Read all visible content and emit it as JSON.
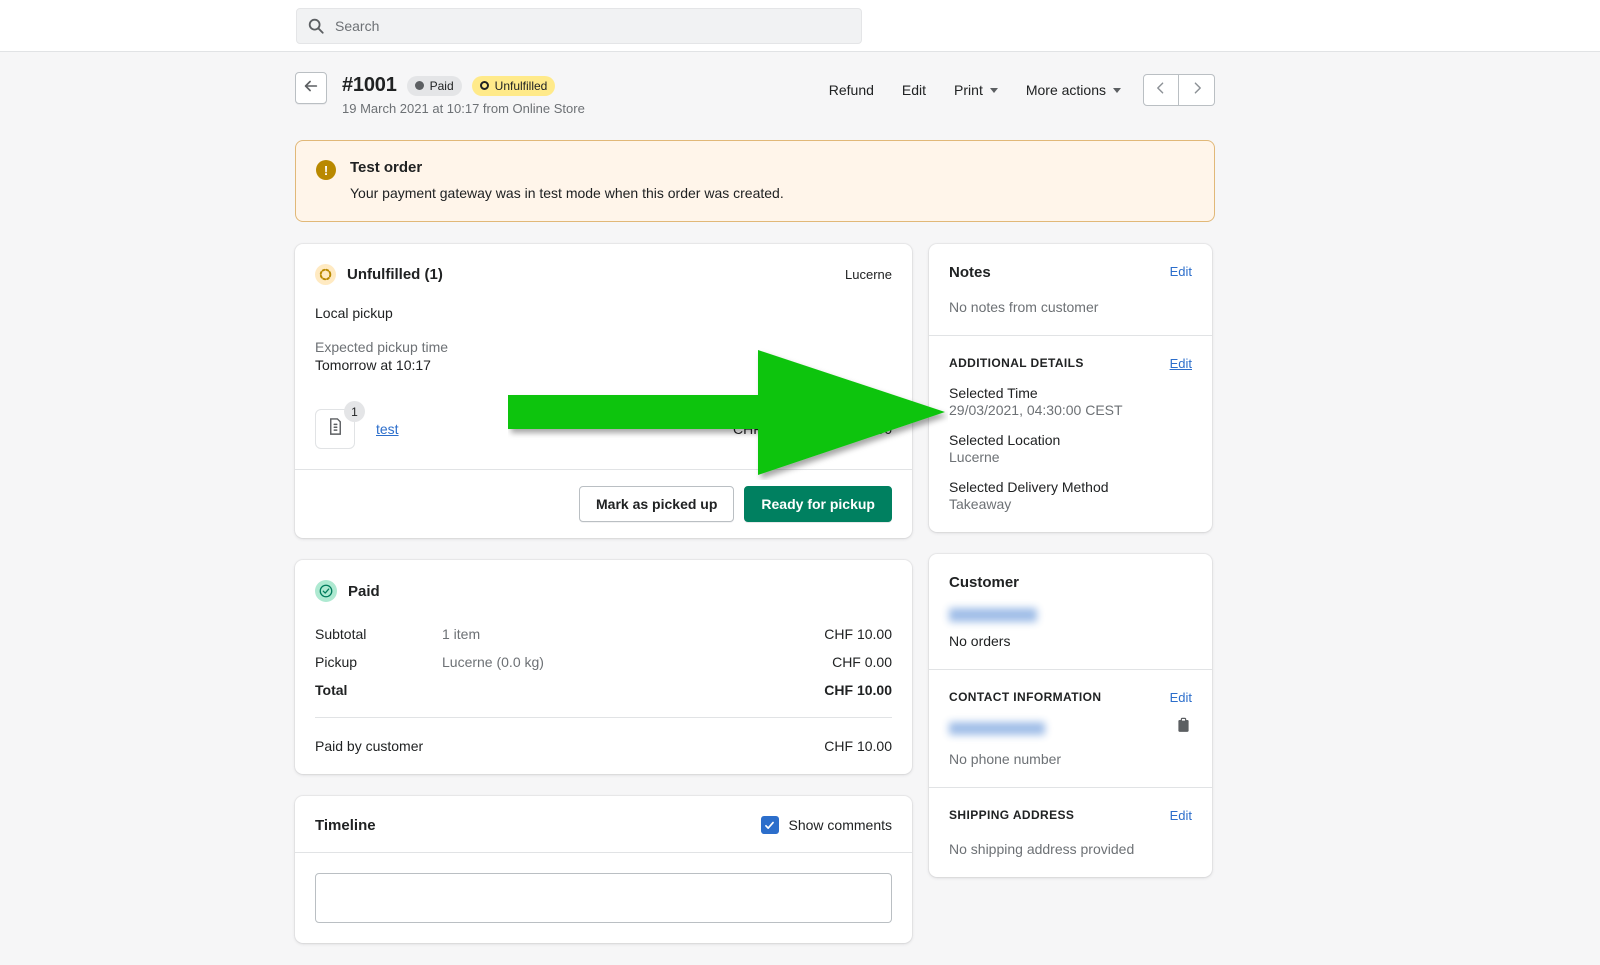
{
  "search": {
    "placeholder": "Search",
    "icon": "search-icon"
  },
  "order": {
    "back_icon": "arrow-left-icon",
    "number": "#1001",
    "payment_badge": "Paid",
    "fulfillment_badge": "Unfulfilled",
    "subtitle": "19 March 2021 at 10:17 from Online Store",
    "actions": [
      {
        "label": "Refund",
        "has_caret": false
      },
      {
        "label": "Edit",
        "has_caret": false
      },
      {
        "label": "Print",
        "has_caret": true
      },
      {
        "label": "More actions",
        "has_caret": true
      }
    ],
    "pager": {
      "prev_icon": "chevron-left-icon",
      "next_icon": "chevron-right-icon"
    }
  },
  "banner": {
    "icon": "alert-icon",
    "title": "Test order",
    "text": "Your payment gateway was in test mode when this order was created."
  },
  "fulfillment": {
    "status_icon": "dashed-ring-icon",
    "title": "Unfulfilled (1)",
    "location": "Lucerne",
    "method": "Local pickup",
    "expected_label": "Expected pickup time",
    "expected_value": "Tomorrow at 10:17",
    "item": {
      "icon": "product-placeholder-icon",
      "quantity": "1",
      "name": "test",
      "unit_price": "CHF 10.00",
      "total_price": "CHF 10.00"
    },
    "secondary_button": "Mark as picked up",
    "primary_button": "Ready for pickup"
  },
  "payment": {
    "status_icon": "check-circle-icon",
    "title": "Paid",
    "rows": [
      {
        "label": "Subtotal",
        "desc": "1 item",
        "amount": "CHF 10.00",
        "bold": false
      },
      {
        "label": "Pickup",
        "desc": "Lucerne (0.0 kg)",
        "amount": "CHF 0.00",
        "bold": false
      },
      {
        "label": "Total",
        "desc": "",
        "amount": "CHF 10.00",
        "bold": true
      }
    ],
    "paid_by_label": "Paid by customer",
    "paid_by_amount": "CHF 10.00"
  },
  "timeline": {
    "title": "Timeline",
    "show_comments_label": "Show comments",
    "show_comments_checked": true
  },
  "notes": {
    "title": "Notes",
    "edit_label": "Edit",
    "empty_text": "No notes from customer"
  },
  "additional_details": {
    "title": "ADDITIONAL DETAILS",
    "edit_label": "Edit",
    "items": [
      {
        "key": "Selected Time",
        "value": "29/03/2021, 04:30:00 CEST"
      },
      {
        "key": "Selected Location",
        "value": "Lucerne"
      },
      {
        "key": "Selected Delivery Method",
        "value": "Takeaway"
      }
    ]
  },
  "customer": {
    "title": "Customer",
    "name_redacted": "redacted",
    "orders_text": "No orders",
    "contact_title": "CONTACT INFORMATION",
    "contact_edit": "Edit",
    "email_redacted": "redacted",
    "copy_icon": "clipboard-icon",
    "no_phone": "No phone number",
    "shipping_title": "SHIPPING ADDRESS",
    "shipping_edit": "Edit",
    "shipping_empty": "No shipping address provided"
  },
  "annotation": {
    "type": "arrow",
    "direction": "right",
    "color": "#10c410",
    "points_to": "Selected Time"
  },
  "colors": {
    "brand_green": "#008060",
    "link_blue": "#2c6ecb",
    "warning_yellow": "#ffea8a",
    "banner_bg": "#fff5ea",
    "annotation_green": "#10c410"
  }
}
